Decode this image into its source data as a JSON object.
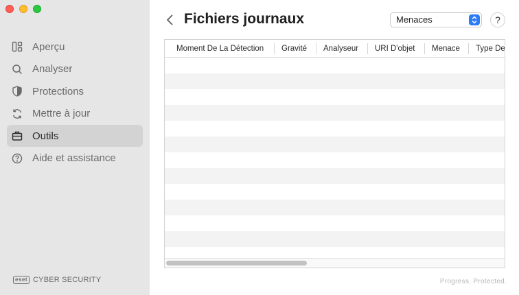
{
  "sidebar": {
    "items": [
      {
        "label": "Aperçu",
        "icon": "overview-icon",
        "active": false
      },
      {
        "label": "Analyser",
        "icon": "search-icon",
        "active": false
      },
      {
        "label": "Protections",
        "icon": "shield-icon",
        "active": false
      },
      {
        "label": "Mettre à jour",
        "icon": "refresh-icon",
        "active": false
      },
      {
        "label": "Outils",
        "icon": "briefcase-icon",
        "active": true
      },
      {
        "label": "Aide et assistance",
        "icon": "help-circle-icon",
        "active": false
      }
    ],
    "brand_logo": "eset",
    "brand_name": "CYBER SECURITY"
  },
  "header": {
    "title": "Fichiers journaux",
    "filter_value": "Menaces",
    "help_label": "?"
  },
  "table": {
    "columns": [
      "Moment De La Détection",
      "Gravité",
      "Analyseur",
      "URI D'objet",
      "Menace",
      "Type De"
    ],
    "rows": []
  },
  "footer": {
    "tagline": "Progress. Protected."
  },
  "colors": {
    "sidebar_bg": "#e6e6e6",
    "active_item_bg": "#d3d3d3",
    "select_accent": "#2c7cf6"
  }
}
